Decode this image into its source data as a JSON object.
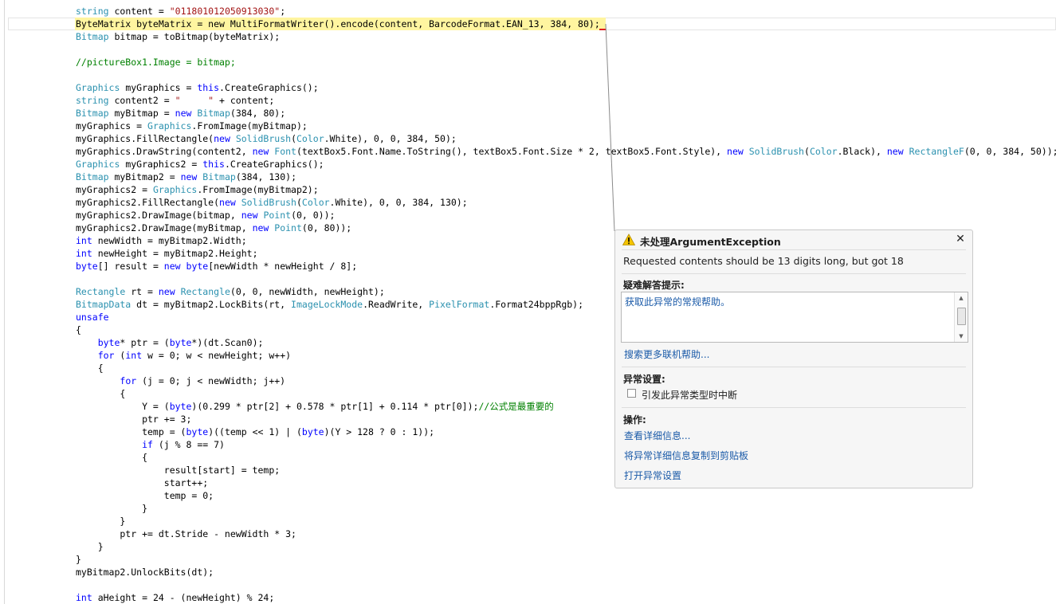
{
  "editor": {
    "lines": [
      {
        "segments": [
          {
            "c": "ty",
            "t": "string"
          },
          {
            "t": " content = "
          },
          {
            "c": "str",
            "t": "\"011801012050913030\""
          },
          {
            "t": ";"
          }
        ]
      },
      {
        "segments": [
          {
            "t": "ByteMatrix byteMatrix = new MultiFormatWriter().encode(content, BarcodeFormat.EAN_13, 384, 80);"
          }
        ]
      },
      {
        "segments": [
          {
            "c": "ty",
            "t": "Bitmap"
          },
          {
            "t": " bitmap = toBitmap(byteMatrix);"
          }
        ]
      },
      {
        "segments": []
      },
      {
        "segments": [
          {
            "c": "cm",
            "t": "//pictureBox1.Image = bitmap;"
          }
        ]
      },
      {
        "segments": []
      },
      {
        "segments": [
          {
            "c": "ty",
            "t": "Graphics"
          },
          {
            "t": " myGraphics = "
          },
          {
            "c": "kw",
            "t": "this"
          },
          {
            "t": ".CreateGraphics();"
          }
        ]
      },
      {
        "segments": [
          {
            "c": "ty",
            "t": "string"
          },
          {
            "t": " content2 = "
          },
          {
            "c": "str",
            "t": "\"     \""
          },
          {
            "t": " + content;"
          }
        ]
      },
      {
        "segments": [
          {
            "c": "ty",
            "t": "Bitmap"
          },
          {
            "t": " myBitmap = "
          },
          {
            "c": "kw",
            "t": "new"
          },
          {
            "t": " "
          },
          {
            "c": "ty",
            "t": "Bitmap"
          },
          {
            "t": "(384, 80);"
          }
        ]
      },
      {
        "segments": [
          {
            "t": "myGraphics = "
          },
          {
            "c": "ty",
            "t": "Graphics"
          },
          {
            "t": ".FromImage(myBitmap);"
          }
        ]
      },
      {
        "segments": [
          {
            "t": "myGraphics.FillRectangle("
          },
          {
            "c": "kw",
            "t": "new"
          },
          {
            "t": " "
          },
          {
            "c": "ty",
            "t": "SolidBrush"
          },
          {
            "t": "("
          },
          {
            "c": "ty",
            "t": "Color"
          },
          {
            "t": ".White), 0, 0, 384, 50);"
          }
        ]
      },
      {
        "segments": [
          {
            "t": "myGraphics.DrawString(content2, "
          },
          {
            "c": "kw",
            "t": "new"
          },
          {
            "t": " "
          },
          {
            "c": "ty",
            "t": "Font"
          },
          {
            "t": "(textBox5.Font.Name.ToString(), textBox5.Font.Size * 2, textBox5.Font.Style), "
          },
          {
            "c": "kw",
            "t": "new"
          },
          {
            "t": " "
          },
          {
            "c": "ty",
            "t": "SolidBrush"
          },
          {
            "t": "("
          },
          {
            "c": "ty",
            "t": "Color"
          },
          {
            "t": ".Black), "
          },
          {
            "c": "kw",
            "t": "new"
          },
          {
            "t": " "
          },
          {
            "c": "ty",
            "t": "RectangleF"
          },
          {
            "t": "(0, 0, 384, 50));"
          }
        ]
      },
      {
        "segments": [
          {
            "c": "ty",
            "t": "Graphics"
          },
          {
            "t": " myGraphics2 = "
          },
          {
            "c": "kw",
            "t": "this"
          },
          {
            "t": ".CreateGraphics();"
          }
        ]
      },
      {
        "segments": [
          {
            "c": "ty",
            "t": "Bitmap"
          },
          {
            "t": " myBitmap2 = "
          },
          {
            "c": "kw",
            "t": "new"
          },
          {
            "t": " "
          },
          {
            "c": "ty",
            "t": "Bitmap"
          },
          {
            "t": "(384, 130);"
          }
        ]
      },
      {
        "segments": [
          {
            "t": "myGraphics2 = "
          },
          {
            "c": "ty",
            "t": "Graphics"
          },
          {
            "t": ".FromImage(myBitmap2);"
          }
        ]
      },
      {
        "segments": [
          {
            "t": "myGraphics2.FillRectangle("
          },
          {
            "c": "kw",
            "t": "new"
          },
          {
            "t": " "
          },
          {
            "c": "ty",
            "t": "SolidBrush"
          },
          {
            "t": "("
          },
          {
            "c": "ty",
            "t": "Color"
          },
          {
            "t": ".White), 0, 0, 384, 130);"
          }
        ]
      },
      {
        "segments": [
          {
            "t": "myGraphics2.DrawImage(bitmap, "
          },
          {
            "c": "kw",
            "t": "new"
          },
          {
            "t": " "
          },
          {
            "c": "ty",
            "t": "Point"
          },
          {
            "t": "(0, 0));"
          }
        ]
      },
      {
        "segments": [
          {
            "t": "myGraphics2.DrawImage(myBitmap, "
          },
          {
            "c": "kw",
            "t": "new"
          },
          {
            "t": " "
          },
          {
            "c": "ty",
            "t": "Point"
          },
          {
            "t": "(0, 80));"
          }
        ]
      },
      {
        "segments": [
          {
            "c": "kw",
            "t": "int"
          },
          {
            "t": " newWidth = myBitmap2.Width;"
          }
        ]
      },
      {
        "segments": [
          {
            "c": "kw",
            "t": "int"
          },
          {
            "t": " newHeight = myBitmap2.Height;"
          }
        ]
      },
      {
        "segments": [
          {
            "c": "kw",
            "t": "byte"
          },
          {
            "t": "[] result = "
          },
          {
            "c": "kw",
            "t": "new"
          },
          {
            "t": " "
          },
          {
            "c": "kw",
            "t": "byte"
          },
          {
            "t": "[newWidth * newHeight / 8];"
          }
        ]
      },
      {
        "segments": []
      },
      {
        "segments": [
          {
            "c": "ty",
            "t": "Rectangle"
          },
          {
            "t": " rt = "
          },
          {
            "c": "kw",
            "t": "new"
          },
          {
            "t": " "
          },
          {
            "c": "ty",
            "t": "Rectangle"
          },
          {
            "t": "(0, 0, newWidth, newHeight);"
          }
        ]
      },
      {
        "segments": [
          {
            "c": "ty",
            "t": "BitmapData"
          },
          {
            "t": " dt = myBitmap2.LockBits(rt, "
          },
          {
            "c": "ty",
            "t": "ImageLockMode"
          },
          {
            "t": ".ReadWrite, "
          },
          {
            "c": "ty",
            "t": "PixelFormat"
          },
          {
            "t": ".Format24bppRgb);"
          }
        ]
      },
      {
        "segments": [
          {
            "c": "kw",
            "t": "unsafe"
          }
        ]
      },
      {
        "segments": [
          {
            "t": "{"
          }
        ]
      },
      {
        "segments": [
          {
            "t": "    "
          },
          {
            "c": "kw",
            "t": "byte"
          },
          {
            "t": "* ptr = ("
          },
          {
            "c": "kw",
            "t": "byte"
          },
          {
            "t": "*)(dt.Scan0);"
          }
        ]
      },
      {
        "segments": [
          {
            "t": "    "
          },
          {
            "c": "kw",
            "t": "for"
          },
          {
            "t": " ("
          },
          {
            "c": "kw",
            "t": "int"
          },
          {
            "t": " w = 0; w < newHeight; w++)"
          }
        ]
      },
      {
        "segments": [
          {
            "t": "    {"
          }
        ]
      },
      {
        "segments": [
          {
            "t": "        "
          },
          {
            "c": "kw",
            "t": "for"
          },
          {
            "t": " (j = 0; j < newWidth; j++)"
          }
        ]
      },
      {
        "segments": [
          {
            "t": "        {"
          }
        ]
      },
      {
        "segments": [
          {
            "t": "            Y = ("
          },
          {
            "c": "kw",
            "t": "byte"
          },
          {
            "t": ")(0.299 * ptr[2] + 0.578 * ptr[1] + 0.114 * ptr[0]);"
          },
          {
            "c": "cm",
            "t": "//公式是最重要的"
          }
        ]
      },
      {
        "segments": [
          {
            "t": "            ptr += 3;"
          }
        ]
      },
      {
        "segments": [
          {
            "t": "            temp = ("
          },
          {
            "c": "kw",
            "t": "byte"
          },
          {
            "t": ")((temp << 1) | ("
          },
          {
            "c": "kw",
            "t": "byte"
          },
          {
            "t": ")(Y > 128 ? 0 : 1));"
          }
        ]
      },
      {
        "segments": [
          {
            "t": "            "
          },
          {
            "c": "kw",
            "t": "if"
          },
          {
            "t": " (j % 8 == 7)"
          }
        ]
      },
      {
        "segments": [
          {
            "t": "            {"
          }
        ]
      },
      {
        "segments": [
          {
            "t": "                result[start] = temp;"
          }
        ]
      },
      {
        "segments": [
          {
            "t": "                start++;"
          }
        ]
      },
      {
        "segments": [
          {
            "t": "                temp = 0;"
          }
        ]
      },
      {
        "segments": [
          {
            "t": "            }"
          }
        ]
      },
      {
        "segments": [
          {
            "t": "        }"
          }
        ]
      },
      {
        "segments": [
          {
            "t": "        ptr += dt.Stride - newWidth * 3;"
          }
        ]
      },
      {
        "segments": [
          {
            "t": "    }"
          }
        ]
      },
      {
        "segments": [
          {
            "t": "}"
          }
        ]
      },
      {
        "segments": [
          {
            "t": "myBitmap2.UnlockBits(dt);"
          }
        ]
      },
      {
        "segments": []
      },
      {
        "segments": [
          {
            "c": "kw",
            "t": "int"
          },
          {
            "t": " aHeight = 24 - (newHeight) % 24;"
          }
        ]
      }
    ],
    "highlight_color": "#fff5a0"
  },
  "exception_popup": {
    "icon": "warning-icon",
    "title": "未处理ArgumentException",
    "close_label": "✕",
    "message": "Requested contents should be 13 digits long, but got 18",
    "tips_heading": "疑难解答提示:",
    "tips_link": "获取此异常的常规帮助。",
    "search_link": "搜索更多联机帮助...",
    "exception_settings_heading": "异常设置:",
    "break_checkbox_label": "引发此异常类型时中断",
    "break_checked": false,
    "actions_heading": "操作:",
    "actions": [
      {
        "label": "查看详细信息..."
      },
      {
        "label": "将异常详细信息复制到剪贴板"
      },
      {
        "label": "打开异常设置"
      }
    ],
    "link_color": "#1a5aa8",
    "warning_color": "#f5c400"
  }
}
